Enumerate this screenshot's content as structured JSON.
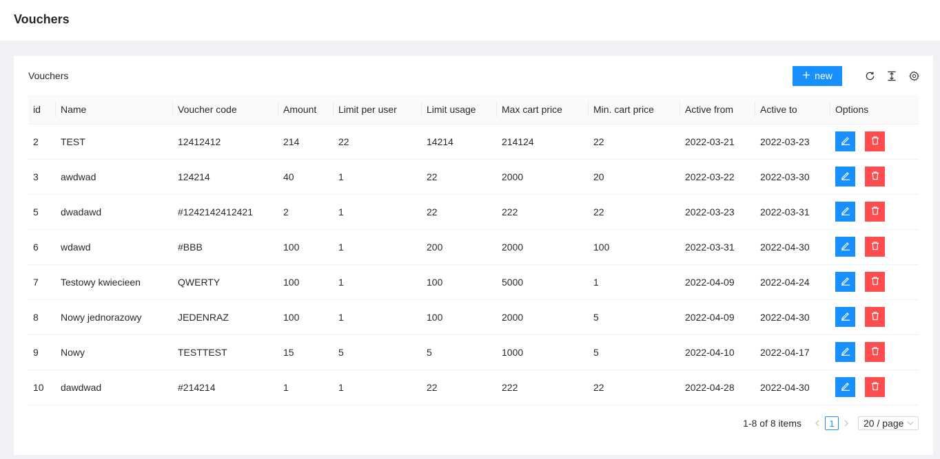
{
  "page": {
    "title": "Vouchers"
  },
  "card": {
    "title": "Vouchers",
    "new_button_label": "new"
  },
  "table": {
    "columns": [
      "id",
      "Name",
      "Voucher code",
      "Amount",
      "Limit per user",
      "Limit usage",
      "Max cart price",
      "Min. cart price",
      "Active from",
      "Active to",
      "Options"
    ],
    "rows": [
      {
        "id": "2",
        "name": "TEST",
        "code": "12412412",
        "amount": "214",
        "limit_per_user": "22",
        "limit_usage": "14214",
        "max_cart": "214124",
        "min_cart": "22",
        "from": "2022-03-21",
        "to": "2022-03-23"
      },
      {
        "id": "3",
        "name": "awdwad",
        "code": "124214",
        "amount": "40",
        "limit_per_user": "1",
        "limit_usage": "22",
        "max_cart": "2000",
        "min_cart": "20",
        "from": "2022-03-22",
        "to": "2022-03-30"
      },
      {
        "id": "5",
        "name": "dwadawd",
        "code": "#1242142412421",
        "amount": "2",
        "limit_per_user": "1",
        "limit_usage": "22",
        "max_cart": "222",
        "min_cart": "22",
        "from": "2022-03-23",
        "to": "2022-03-31"
      },
      {
        "id": "6",
        "name": "wdawd",
        "code": "#BBB",
        "amount": "100",
        "limit_per_user": "1",
        "limit_usage": "200",
        "max_cart": "2000",
        "min_cart": "100",
        "from": "2022-03-31",
        "to": "2022-04-30"
      },
      {
        "id": "7",
        "name": "Testowy kwiecieen",
        "code": "QWERTY",
        "amount": "100",
        "limit_per_user": "1",
        "limit_usage": "100",
        "max_cart": "5000",
        "min_cart": "1",
        "from": "2022-04-09",
        "to": "2022-04-24"
      },
      {
        "id": "8",
        "name": "Nowy jednorazowy",
        "code": "JEDENRAZ",
        "amount": "100",
        "limit_per_user": "1",
        "limit_usage": "100",
        "max_cart": "2000",
        "min_cart": "5",
        "from": "2022-04-09",
        "to": "2022-04-30"
      },
      {
        "id": "9",
        "name": "Nowy",
        "code": "TESTTEST",
        "amount": "15",
        "limit_per_user": "5",
        "limit_usage": "5",
        "max_cart": "1000",
        "min_cart": "5",
        "from": "2022-04-10",
        "to": "2022-04-17"
      },
      {
        "id": "10",
        "name": "dawdwad",
        "code": "#214214",
        "amount": "1",
        "limit_per_user": "1",
        "limit_usage": "22",
        "max_cart": "222",
        "min_cart": "22",
        "from": "2022-04-28",
        "to": "2022-04-30"
      }
    ]
  },
  "pagination": {
    "total_label": "1-8 of 8 items",
    "current_page": "1",
    "page_size_label": "20 / page"
  },
  "icons": {
    "new": "plus-icon",
    "reload": "reload-icon",
    "density": "column-height-icon",
    "settings": "setting-icon",
    "edit": "edit-icon",
    "delete": "delete-icon"
  },
  "colors": {
    "primary": "#1890ff",
    "danger": "#ff4d4f"
  }
}
